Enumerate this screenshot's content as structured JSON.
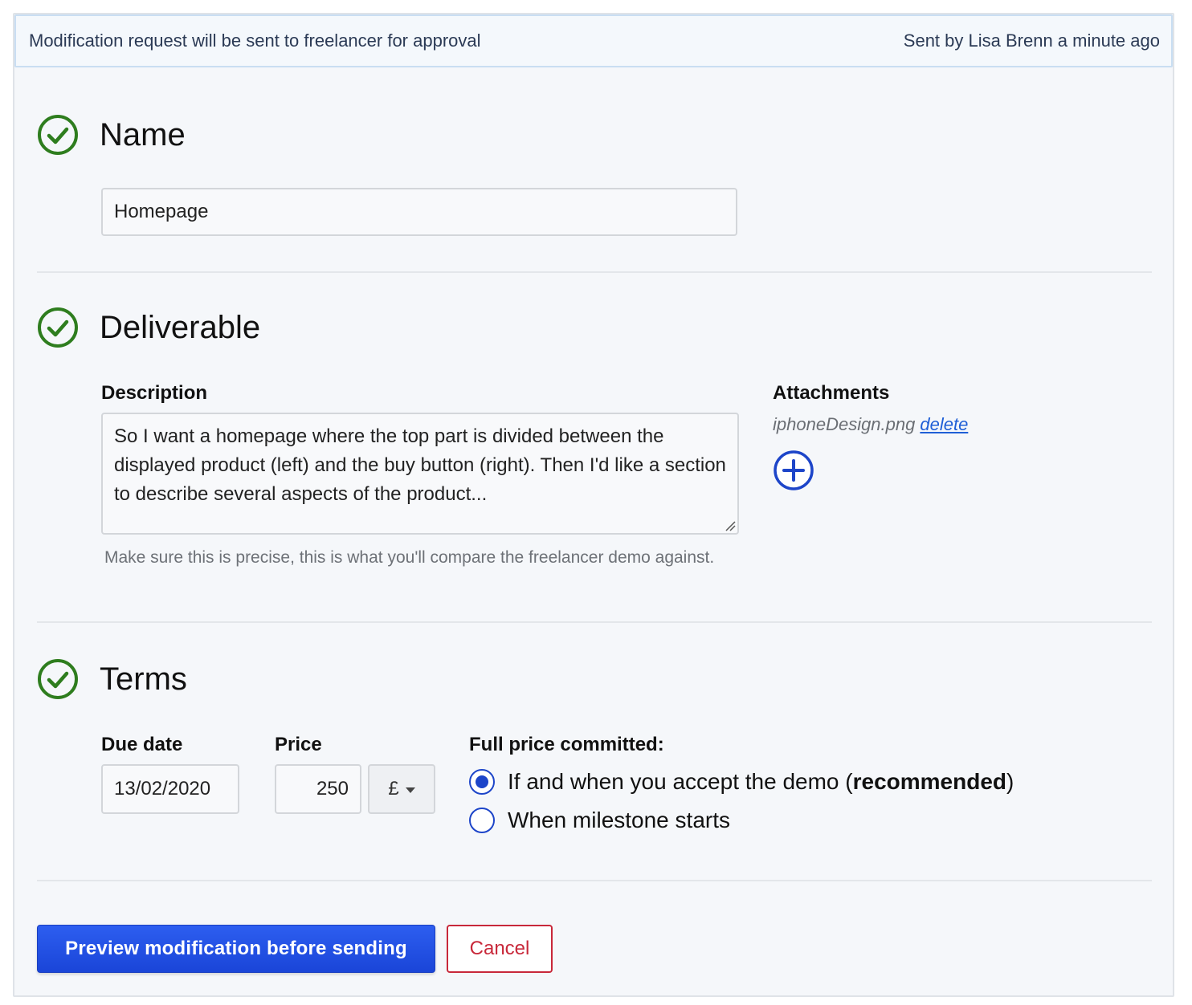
{
  "banner": {
    "message": "Modification request will be sent to freelancer for approval",
    "meta": "Sent by Lisa Brenn a minute ago"
  },
  "sections": {
    "name": {
      "title": "Name",
      "input_value": "Homepage",
      "icon": "check-circle-icon"
    },
    "deliverable": {
      "title": "Deliverable",
      "icon": "check-circle-icon",
      "description_label": "Description",
      "description_value": "So I want a homepage where the top part is divided between the displayed product (left) and the buy button (right). Then I'd like a section to describe several aspects of the product...",
      "hint": "Make sure this is precise, this is what you'll compare the freelancer demo against.",
      "attachments_label": "Attachments",
      "attachment_file": "iphoneDesign.png",
      "attachment_delete": "delete",
      "add_icon": "plus-circle-icon"
    },
    "terms": {
      "title": "Terms",
      "icon": "check-circle-icon",
      "due_date_label": "Due date",
      "due_date_value": "13/02/2020",
      "price_label": "Price",
      "price_value": "250",
      "currency": "£",
      "commit_label": "Full price committed:",
      "options": [
        {
          "label_pre": "If and when you accept the demo (",
          "label_bold": "recommended",
          "label_post": ")",
          "checked": true
        },
        {
          "label": "When milestone starts",
          "checked": false
        }
      ]
    }
  },
  "actions": {
    "preview_label": "Preview modification before sending",
    "cancel_label": "Cancel"
  },
  "colors": {
    "accent": "#1d45c9",
    "success": "#2e7d1e",
    "danger": "#c8283a",
    "link": "#1f5fd6"
  }
}
